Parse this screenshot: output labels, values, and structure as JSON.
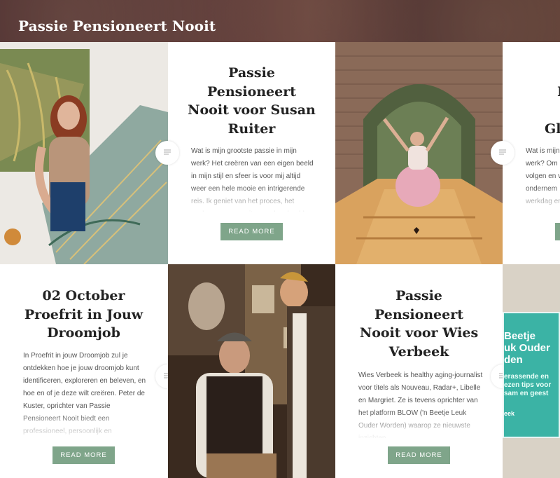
{
  "site": {
    "title": "Passie Pensioneert Nooit"
  },
  "posts": [
    {
      "title": "Passie Pensioneert Nooit voor Susan Ruiter",
      "excerpt": "Wat is mijn grootste passie in mijn werk? Het creëren van een eigen beeld in mijn stijl en sfeer is voor mij altijd weer een hele mooie en intrigerende reis. Ik geniet van het proces, het zoeken naar een uitgesproken beeld",
      "button": "READ MORE"
    },
    {
      "title": "Pe... N... Glar...",
      "excerpt": "Wat is mijn... werk? Om ... volgen en v... ondernem... werkdag en...",
      "button": "READ MORE"
    },
    {
      "title": "02 October Proefrit in Jouw Droomjob",
      "excerpt": "In Proefrit in jouw Droomjob zul je ontdekken hoe je jouw droomjob kunt identificeren, exploreren en beleven, en hoe en of je deze wilt creëren. Peter de Kuster, oprichter van Passie Pensioneert Nooit biedt een professioneel, persoonlijk en",
      "button": "READ MORE"
    },
    {
      "title": "Passie Pensioneert Nooit voor Wies Verbeek",
      "excerpt": "Wies Verbeek is healthy aging-journalist voor titels als Nouveau, Radar+, Libelle en Margriet. Ze is tevens oprichter van het platform BLOW ('n Beetje Leuk Ouder Worden) waarop ze nieuwste inzichten",
      "button": "READ MORE"
    }
  ],
  "book_cover": {
    "lines": [
      "Beetje",
      "uk Ouder",
      "den"
    ],
    "sub": "erassende en ezen tips voor sam en geest",
    "author": "eek"
  },
  "colors": {
    "button": "#7fa58a",
    "header": "#4f3233"
  },
  "icons": {
    "post_format": "text-lines-icon"
  }
}
